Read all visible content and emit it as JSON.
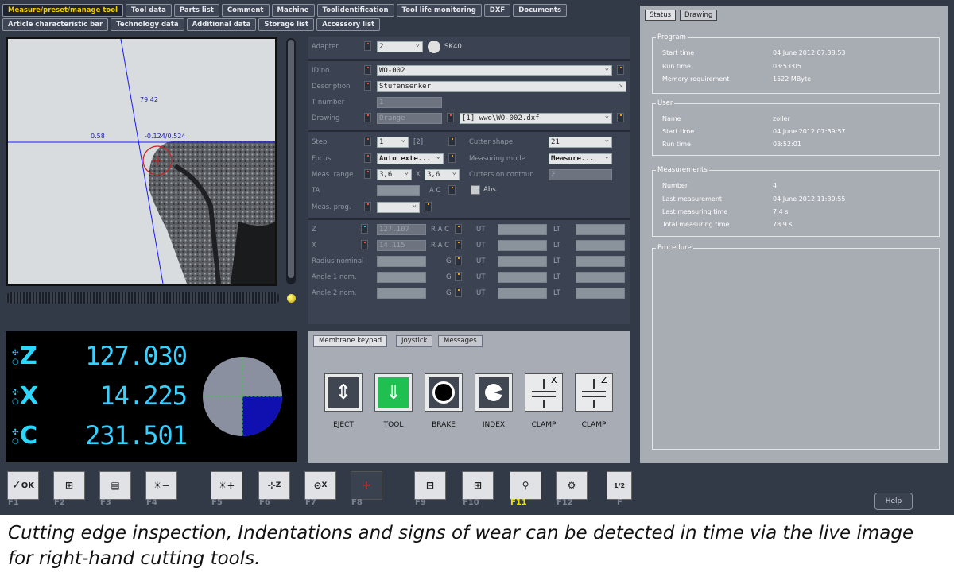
{
  "tabs_row1": [
    "Measure/preset/manage tool",
    "Tool data",
    "Parts list",
    "Comment",
    "Machine",
    "Toolidentification",
    "Tool life monitoring",
    "DXF",
    "Documents"
  ],
  "tabs_row2": [
    "Article characteristic bar",
    "Technology data",
    "Additional data",
    "Storage list",
    "Accessory list"
  ],
  "camera": {
    "v1": "79.42",
    "h1": "0.58",
    "pos": "-0.124/0.524"
  },
  "form": {
    "adapter_label": "Adapter",
    "adapter_value": "2",
    "adapter_type": "SK40",
    "id_label": "ID no.",
    "id_value": "WO-002",
    "desc_label": "Description",
    "desc_value": "Stufensenker",
    "tnum_label": "T number",
    "tnum_value": "1",
    "drawing_label": "Drawing",
    "drawing_value": "Orange",
    "drawing_file": "[1] wwo\\WO-002.dxf",
    "step_label": "Step",
    "step_value": "1",
    "step_count": "[2]",
    "cutter_label": "Cutter shape",
    "cutter_value": "21",
    "focus_label": "Focus",
    "focus_value": "Auto exte...",
    "mmode_label": "Measuring mode",
    "mmode_value": "Measure...",
    "range_label": "Meas. range",
    "range_x": "3,6",
    "range_sep": "X",
    "range_y": "3,6",
    "cutters_label": "Cutters on contour",
    "cutters_value": "2",
    "ta_label": "TA",
    "ac_label": "A C",
    "abs_label": "Abs.",
    "prog_label": "Meas. prog.",
    "z_label": "Z",
    "z_value": "127.107",
    "z_rac": "R A C",
    "z_ut": "UT",
    "z_lt": "LT",
    "x_label": "X",
    "x_value": "14.115",
    "x_rac": "R A C",
    "x_ut": "UT",
    "x_lt": "LT",
    "rad_label": "Radius nominal",
    "rad_g": "G",
    "rad_ut": "UT",
    "rad_lt": "LT",
    "a1_label": "Angle 1 nom.",
    "a1_g": "G",
    "a1_ut": "UT",
    "a1_lt": "LT",
    "a2_label": "Angle 2 nom.",
    "a2_g": "G",
    "a2_ut": "UT",
    "a2_lt": "LT"
  },
  "dro": {
    "z_axis": "Z",
    "z_value": "127.030",
    "x_axis": "X",
    "x_value": "14.225",
    "c_axis": "C",
    "c_value": "231.501"
  },
  "keypad": {
    "tabs": [
      "Membrane keypad",
      "Joystick",
      "Messages"
    ],
    "buttons": [
      "EJECT",
      "TOOL",
      "BRAKE",
      "INDEX",
      "CLAMP",
      "CLAMP"
    ],
    "x_mark": "X",
    "z_mark": "Z"
  },
  "status": {
    "tabs": [
      "Status",
      "Drawing"
    ],
    "program_title": "Program",
    "program": [
      [
        "Start time",
        "04 June 2012 07:38:53"
      ],
      [
        "Run time",
        "03:53:05"
      ],
      [
        "Memory requirement",
        "1522 MByte"
      ]
    ],
    "user_title": "User",
    "user": [
      [
        "Name",
        "zoller"
      ],
      [
        "Start time",
        "04 June 2012 07:39:57"
      ],
      [
        "Run time",
        "03:52:01"
      ]
    ],
    "meas_title": "Measurements",
    "meas": [
      [
        "Number",
        "4"
      ],
      [
        "Last measurement",
        "04 June 2012 11:30:55"
      ],
      [
        "Last measuring time",
        "7.4 s"
      ],
      [
        "Total measuring time",
        "78.9 s"
      ]
    ],
    "proc_title": "Procedure"
  },
  "fkeys": [
    "F1",
    "F2",
    "F3",
    "F4",
    "F5",
    "F6",
    "F7",
    "F8",
    "F9",
    "F10",
    "F11",
    "F12",
    "F"
  ],
  "fkey_glyphs": {
    "ok": "OK",
    "minus": "−",
    "plus": "+",
    "z": "Z",
    "x": "X",
    "page": "1/2"
  },
  "help_label": "Help",
  "caption": "Cutting edge inspection, Indentations and signs of wear can be detected in time via the live image for right-hand cutting tools."
}
